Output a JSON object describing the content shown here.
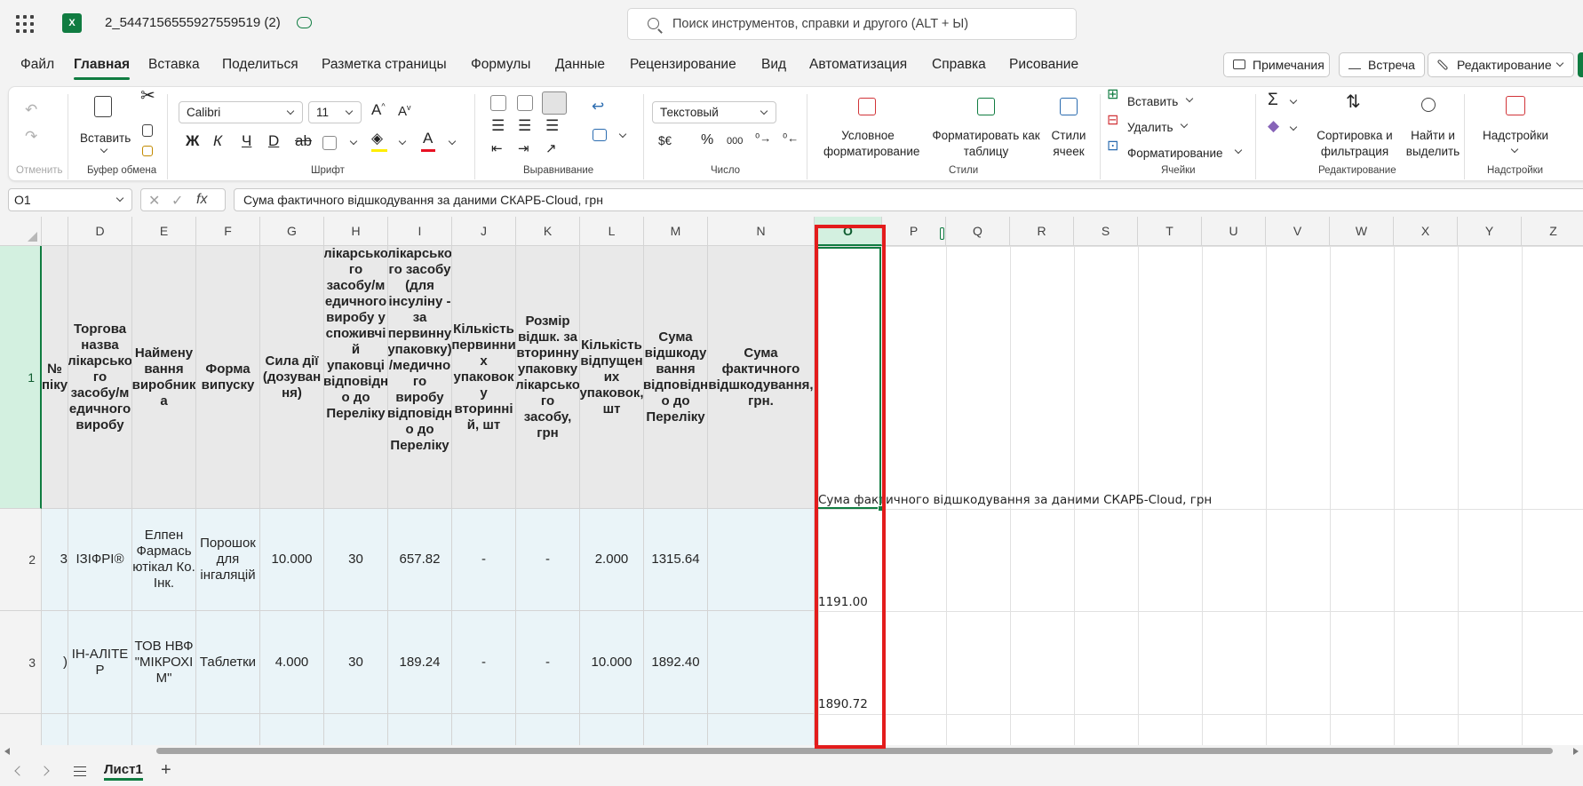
{
  "app": {
    "doc_title": "2_5447156555927559519 (2)",
    "search_placeholder": "Поиск инструментов, справки и другого (ALT + Ы)"
  },
  "menu": {
    "tabs": [
      "Файл",
      "Главная",
      "Вставка",
      "Поделиться",
      "Разметка страницы",
      "Формулы",
      "Данные",
      "Рецензирование",
      "Вид",
      "Автоматизация",
      "Справка",
      "Рисование"
    ],
    "active": "Главная",
    "comments_label": "Примечания",
    "meeting_label": "Встреча",
    "editing_label": "Редактирование"
  },
  "ribbon": {
    "undo_group": "Отменить",
    "clipboard": {
      "paste_label": "Вставить",
      "group": "Буфер обмена"
    },
    "font": {
      "name": "Calibri",
      "size": "11",
      "group": "Шрифт"
    },
    "alignment_group": "Выравнивание",
    "number": {
      "format": "Текстовый",
      "currency": "$€",
      "percent": "%",
      "thousands": "000",
      "group": "Число"
    },
    "styles": {
      "conditional_line1": "Условное",
      "conditional_line2": "форматирование",
      "table_line1": "Форматировать как",
      "table_line2": "таблицу",
      "cell_styles_line1": "Стили",
      "cell_styles_line2": "ячеек",
      "group": "Стили"
    },
    "cells": {
      "insert": "Вставить",
      "delete": "Удалить",
      "format": "Форматирование",
      "group": "Ячейки"
    },
    "editing": {
      "sort_line1": "Сортировка и",
      "sort_line2": "фильтрация",
      "find_line1": "Найти и",
      "find_line2": "выделить",
      "group": "Редактирование"
    },
    "addins": {
      "label": "Надстройки",
      "group": "Надстройки"
    }
  },
  "formula_bar": {
    "cell_ref": "O1",
    "formula": "Сума фактичного відшкодування за даними СКАРБ-Cloud, грн"
  },
  "grid": {
    "columns": [
      "D",
      "E",
      "F",
      "G",
      "H",
      "I",
      "J",
      "K",
      "L",
      "M",
      "N",
      "O",
      "P",
      "Q",
      "R",
      "S",
      "T",
      "U",
      "V",
      "W",
      "X",
      "Y",
      "Z"
    ],
    "selected_column": "O",
    "rows": [
      "1",
      "2",
      "3"
    ],
    "header_c": "№ піку",
    "header_d": "Торгова назва лікарсько го засобу/м едичного виробу",
    "header_e": "Наймену вання виробник а",
    "header_f": "Форма випуску",
    "header_g": "Сила дії (дозуван ня)",
    "header_h": "лікарсько го засобу/м едичного виробу у споживчі й упаковці відповідн о до Переліку",
    "header_i": "лікарсько го засобу (для інсуліну - за первинну упаковку) /медично го виробу відповідн о до Переліку",
    "header_j": "Кількість первинни х упаковок у вторинні й, шт",
    "header_k": "Розмір відшк. за вторинну упаковку лікарсько го засобу, грн",
    "header_l": "Кількість відпущен их упаковок, шт",
    "header_m": "Сума відшкоду вання відповідн о до Переліку",
    "header_n": "Сума фактичного відшкодування, грн.",
    "o1": "Сума фактичного відшкодування за даними СКАРБ-Cloud, грн",
    "row2": {
      "c": "3",
      "d": "ІЗІФРІ®",
      "e": "Елпен Фармась ютікал Ко. Інк.",
      "f": "Порошок для інгаляцій",
      "g": "10.000",
      "h": "30",
      "i": "657.82",
      "j": "-",
      "k": "-",
      "l": "2.000",
      "m": "1315.64",
      "o": "1191.00"
    },
    "row3": {
      "c": ")",
      "d": "ІН-АЛІТЕ Р",
      "e": "ТОВ НВФ \"МІКРОХІ М\"",
      "f": "Таблетки",
      "g": "4.000",
      "h": "30",
      "i": "189.24",
      "j": "-",
      "k": "-",
      "l": "10.000",
      "m": "1892.40",
      "o": "1890.72"
    }
  },
  "sheets": {
    "active": "Лист1"
  }
}
